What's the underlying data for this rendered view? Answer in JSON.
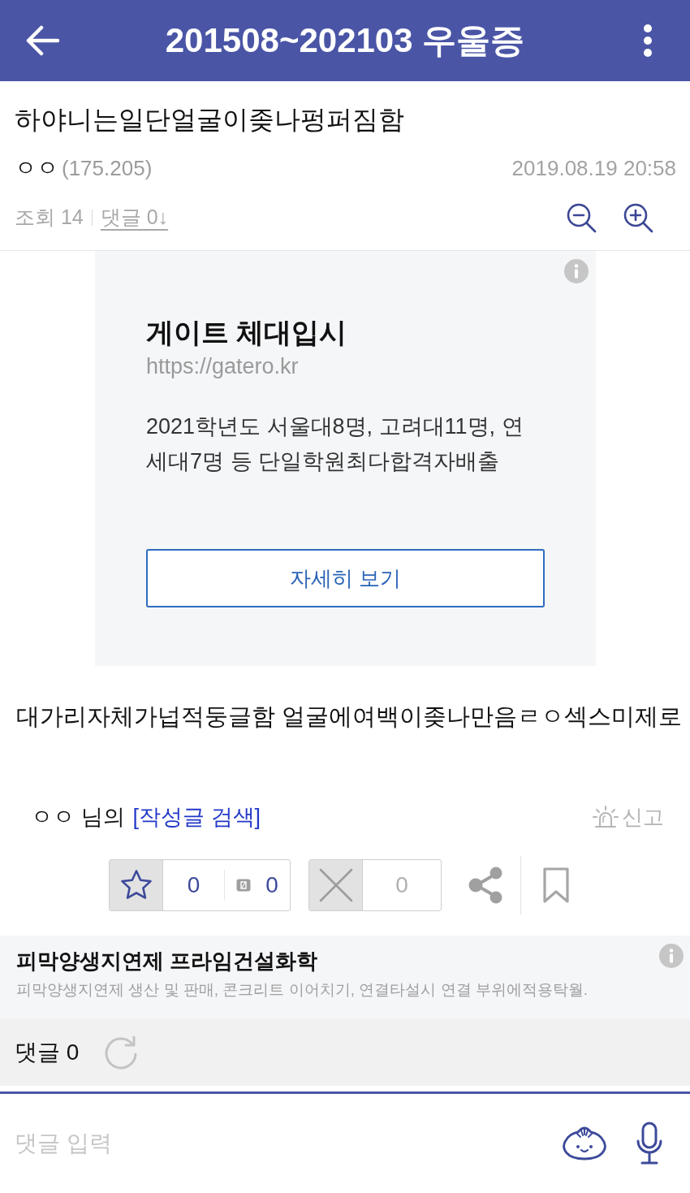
{
  "app_bar": {
    "title": "201508~202103 우울증"
  },
  "post": {
    "title": "하야니는일단얼굴이좆나펑퍼짐함",
    "author": "ㅇㅇ",
    "ip": "(175.205)",
    "date": "2019.08.19 20:58",
    "views": "조회 14",
    "comments_link": "댓글 0↓"
  },
  "ad": {
    "title": "게이트 체대입시",
    "url": "https://gatero.kr",
    "description": "2021학년도 서울대8명, 고려대11명, 연세대7명 등 단일학원최다합격자배출",
    "button": "자세히 보기"
  },
  "body": {
    "text": "대가리자체가넙적둥글함 얼굴에여백이좆나만음ㄹㅇ섹스미제로"
  },
  "author_search": {
    "author": "ㅇㅇ",
    "suffix": "님의",
    "link": "[작성글 검색]"
  },
  "report": {
    "label": "신고"
  },
  "votes": {
    "recommend_count": "0",
    "secondary_count": "0",
    "downvote_count": "0"
  },
  "text_ad": {
    "title": "피막양생지연제 프라임건설화학",
    "description": "피막양생지연제 생산 및 판매, 콘크리트 이어치기, 연결타설시 연결 부위에적용탁월."
  },
  "comments": {
    "label": "댓글 0"
  },
  "comment_input": {
    "placeholder": "댓글 입력"
  }
}
